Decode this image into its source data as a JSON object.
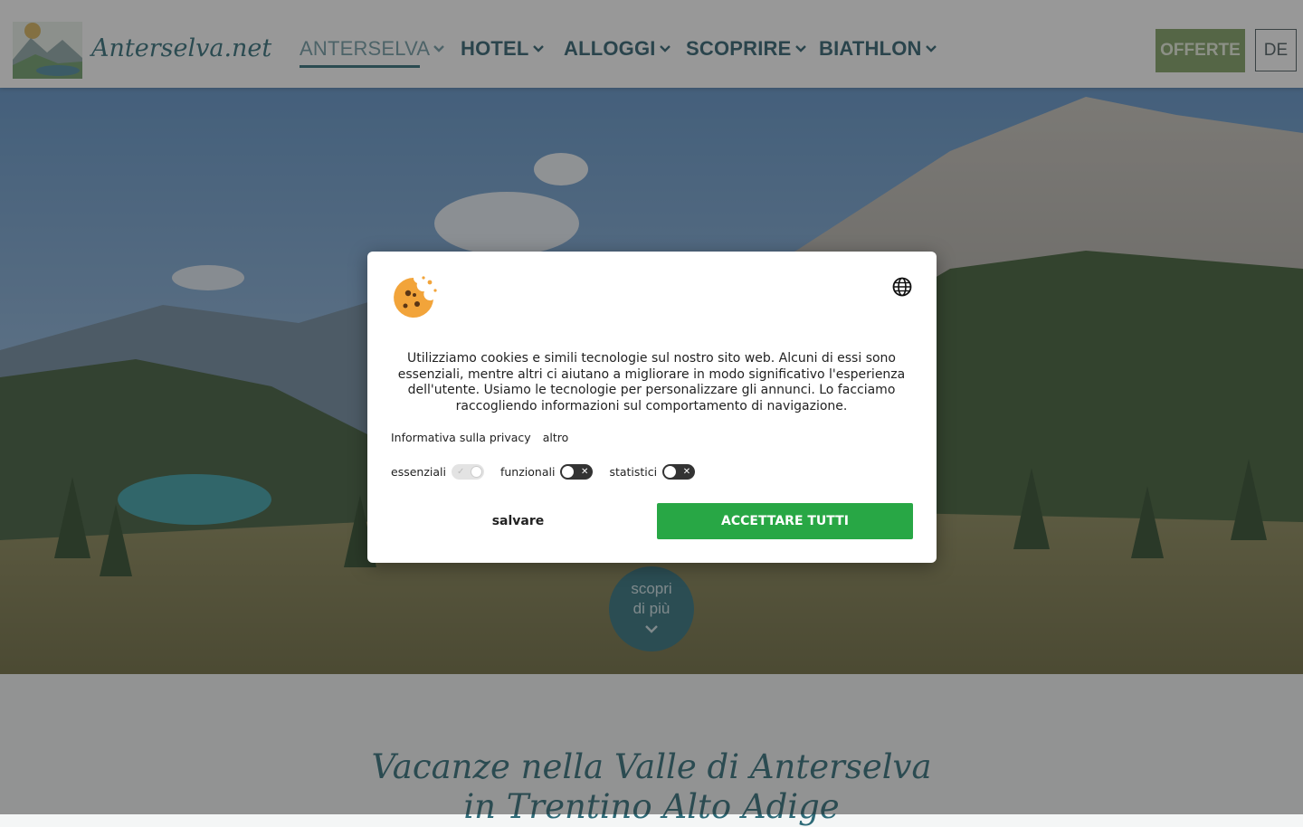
{
  "header": {
    "logo_text": "Anterselva.net",
    "nav": [
      {
        "label": "ANTERSELVA",
        "active": true
      },
      {
        "label": "HOTEL",
        "active": false
      },
      {
        "label": "ALLOGGI",
        "active": false
      },
      {
        "label": "SCOPRIRE",
        "active": false
      },
      {
        "label": "BIATHLON",
        "active": false
      }
    ],
    "offers_label": "OFFERTE",
    "lang_label": "DE"
  },
  "hero": {
    "scroll_label": "scopri di più",
    "scroll_icon": "chevron-down-icon"
  },
  "intro": {
    "title_line1": "Vacanze nella Valle di Anterselva",
    "title_line2": "in Trentino Alto Adige"
  },
  "cookie_banner": {
    "icon": "cookie-icon",
    "language_icon": "globe-icon",
    "text": "Utilizziamo cookies e simili tecnologie sul nostro sito web. Alcuni di essi sono essenziali, mentre altri ci aiutano a migliorare in modo significativo l'esperienza dell'utente. Usiamo le tecnologie per personalizzare gli annunci. Lo facciamo raccogliendo informazioni sul comportamento di navigazione.",
    "privacy_link": "Informativa sulla privacy",
    "more_link": "altro",
    "toggles": [
      {
        "label": "essenziali",
        "state": "on",
        "disabled": true
      },
      {
        "label": "funzionali",
        "state": "off"
      },
      {
        "label": "statistici",
        "state": "off"
      }
    ],
    "save_label": "salvare",
    "accept_label": "ACCETTARE TUTTI",
    "accept_color": "#28a745"
  }
}
